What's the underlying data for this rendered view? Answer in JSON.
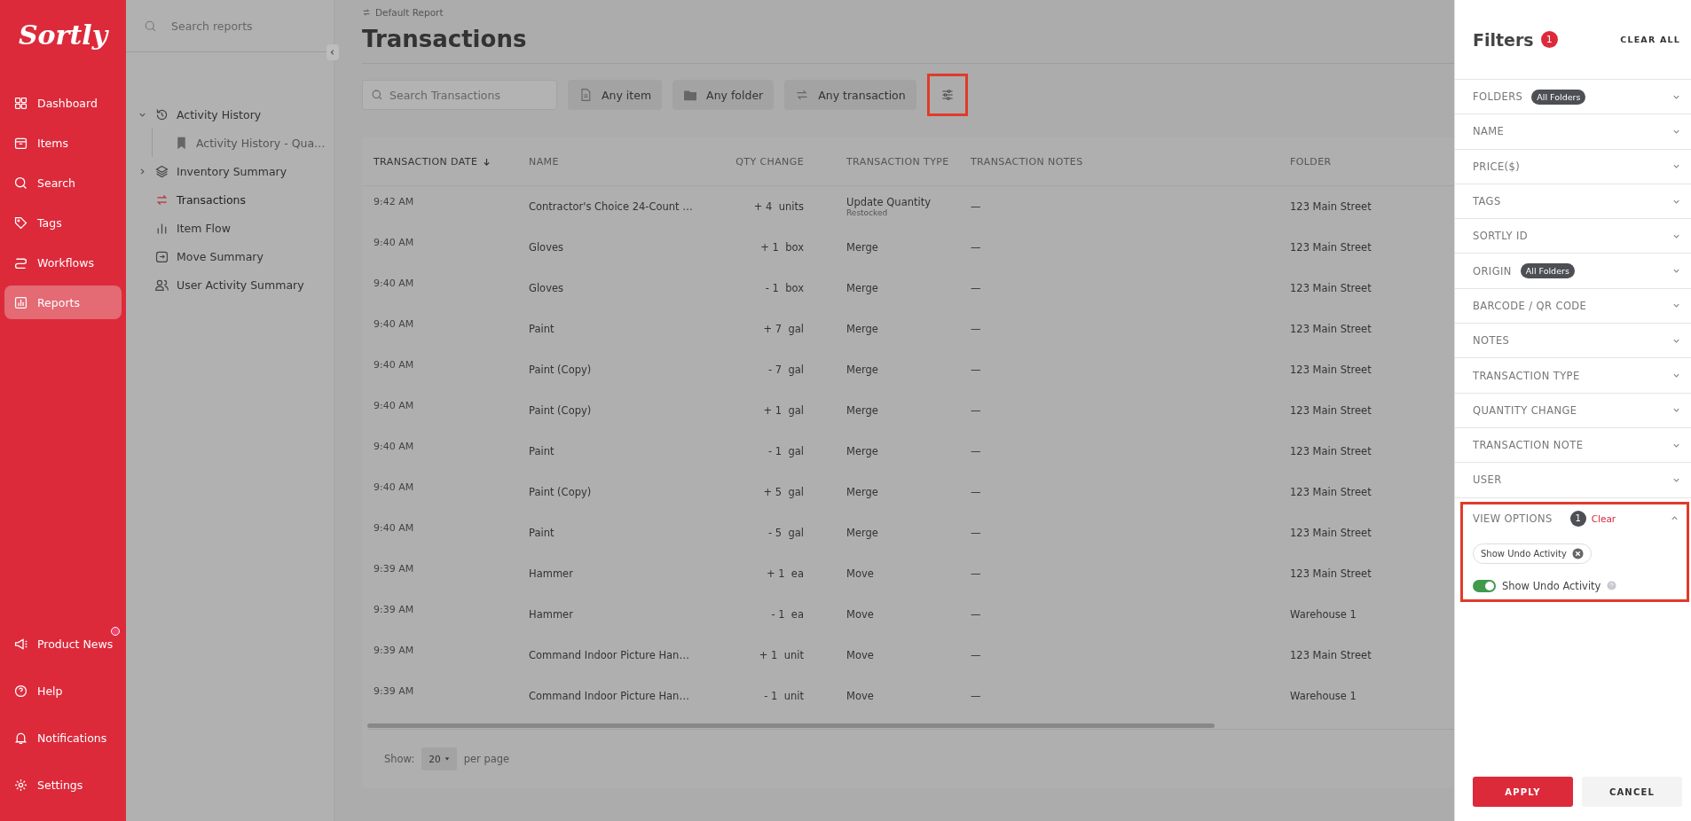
{
  "nav": {
    "logo": "Sortly",
    "items": [
      {
        "label": "Dashboard",
        "selected": false
      },
      {
        "label": "Items",
        "selected": false
      },
      {
        "label": "Search",
        "selected": false
      },
      {
        "label": "Tags",
        "selected": false
      },
      {
        "label": "Workflows",
        "selected": false
      },
      {
        "label": "Reports",
        "selected": true
      }
    ],
    "bottom_items": [
      {
        "label": "Product News",
        "has_update": true
      },
      {
        "label": "Help",
        "has_update": false
      },
      {
        "label": "Notifications",
        "has_update": false
      },
      {
        "label": "Settings",
        "has_update": false
      }
    ]
  },
  "reports_sidebar": {
    "search": {
      "placeholder": "Search reports"
    },
    "tree": [
      {
        "label": "Activity History",
        "expanded": true,
        "selected": false,
        "children": [
          {
            "label": "Activity History - Qua…",
            "selected": false
          }
        ]
      },
      {
        "label": "Inventory Summary",
        "expanded": false,
        "selected": false
      },
      {
        "label": "Transactions",
        "selected": true
      },
      {
        "label": "Item Flow",
        "selected": false
      },
      {
        "label": "Move Summary",
        "selected": false
      },
      {
        "label": "User Activity Summary",
        "selected": false
      }
    ]
  },
  "header": {
    "breadcrumb": "Default Report",
    "title": "Transactions"
  },
  "toolbar": {
    "search": {
      "placeholder": "Search Transactions"
    },
    "chips": [
      "Any item",
      "Any folder",
      "Any transaction"
    ],
    "filter_button": {
      "highlighted": true
    }
  },
  "table": {
    "columns": [
      {
        "label": "TRANSACTION DATE",
        "sorted": true
      },
      {
        "label": "NAME",
        "sorted": false
      },
      {
        "label": "QTY CHANGE",
        "sorted": false
      },
      {
        "label": "TRANSACTION TYPE",
        "sorted": false
      },
      {
        "label": "TRANSACTION NOTES",
        "sorted": false
      },
      {
        "label": "FOLDER",
        "sorted": false
      }
    ],
    "rows": [
      {
        "time": "9:42 AM",
        "name": "Contractor's Choice 24-Count …",
        "qty": "+ 4",
        "unit": "units",
        "type": "Update Quantity",
        "subtype": "Restocked",
        "notes": "—",
        "folder": "123 Main Street"
      },
      {
        "time": "9:40 AM",
        "name": "Gloves",
        "qty": "+ 1",
        "unit": "box",
        "type": "Merge",
        "notes": "—",
        "folder": "123 Main Street"
      },
      {
        "time": "9:40 AM",
        "name": "Gloves",
        "qty": "- 1",
        "unit": "box",
        "type": "Merge",
        "notes": "—",
        "folder": "123 Main Street"
      },
      {
        "time": "9:40 AM",
        "name": "Paint",
        "qty": "+ 7",
        "unit": "gal",
        "type": "Merge",
        "notes": "—",
        "folder": "123 Main Street"
      },
      {
        "time": "9:40 AM",
        "name": "Paint (Copy)",
        "qty": "- 7",
        "unit": "gal",
        "type": "Merge",
        "notes": "—",
        "folder": "123 Main Street"
      },
      {
        "time": "9:40 AM",
        "name": "Paint (Copy)",
        "qty": "+ 1",
        "unit": "gal",
        "type": "Merge",
        "notes": "—",
        "folder": "123 Main Street"
      },
      {
        "time": "9:40 AM",
        "name": "Paint",
        "qty": "- 1",
        "unit": "gal",
        "type": "Merge",
        "notes": "—",
        "folder": "123 Main Street"
      },
      {
        "time": "9:40 AM",
        "name": "Paint (Copy)",
        "qty": "+ 5",
        "unit": "gal",
        "type": "Merge",
        "notes": "—",
        "folder": "123 Main Street"
      },
      {
        "time": "9:40 AM",
        "name": "Paint",
        "qty": "- 5",
        "unit": "gal",
        "type": "Merge",
        "notes": "—",
        "folder": "123 Main Street"
      },
      {
        "time": "9:39 AM",
        "name": "Hammer",
        "qty": "+ 1",
        "unit": "ea",
        "type": "Move",
        "notes": "—",
        "folder": "123 Main Street"
      },
      {
        "time": "9:39 AM",
        "name": "Hammer",
        "qty": "- 1",
        "unit": "ea",
        "type": "Move",
        "notes": "—",
        "folder": "Warehouse 1"
      },
      {
        "time": "9:39 AM",
        "name": "Command Indoor Picture Han…",
        "qty": "+ 1",
        "unit": "unit",
        "type": "Move",
        "notes": "—",
        "folder": "123 Main Street"
      },
      {
        "time": "9:39 AM",
        "name": "Command Indoor Picture Han…",
        "qty": "- 1",
        "unit": "unit",
        "type": "Move",
        "notes": "—",
        "folder": "Warehouse 1"
      }
    ],
    "footer": {
      "show_label": "Show:",
      "page_size": "20",
      "per_page_label": "per page"
    }
  },
  "filters": {
    "title": "Filters",
    "count": "1",
    "clear_all": "CLEAR ALL",
    "sections": [
      {
        "label": "FOLDERS",
        "badge": "All Folders",
        "expanded": false
      },
      {
        "label": "NAME",
        "expanded": false
      },
      {
        "label": "PRICE($)",
        "expanded": false
      },
      {
        "label": "TAGS",
        "expanded": false
      },
      {
        "label": "SORTLY ID",
        "expanded": false
      },
      {
        "label": "ORIGIN",
        "badge": "All Folders",
        "expanded": false
      },
      {
        "label": "BARCODE / QR CODE",
        "expanded": false
      },
      {
        "label": "NOTES",
        "expanded": false
      },
      {
        "label": "TRANSACTION TYPE",
        "expanded": false
      },
      {
        "label": "QUANTITY CHANGE",
        "expanded": false
      },
      {
        "label": "TRANSACTION NOTE",
        "expanded": false
      },
      {
        "label": "USER",
        "expanded": false
      }
    ],
    "view_options": {
      "label": "VIEW OPTIONS",
      "count": "1",
      "clear": "Clear",
      "expanded": true,
      "highlighted": true,
      "chip": "Show Undo Activity",
      "toggle": {
        "label": "Show Undo Activity",
        "on": true
      }
    },
    "apply": "APPLY",
    "cancel": "CANCEL"
  }
}
